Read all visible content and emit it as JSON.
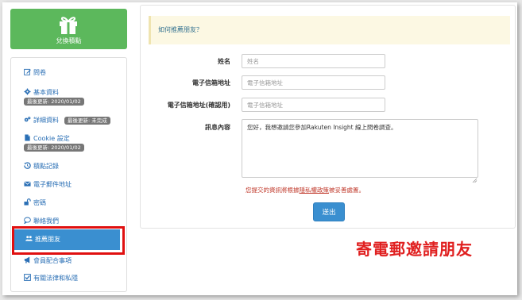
{
  "redeem": {
    "label": "兌換積點"
  },
  "sidebar": {
    "items": [
      {
        "label": "問卷",
        "icon": "edit-icon"
      },
      {
        "label": "基本資料",
        "icon": "gear-icon",
        "badge": "最後更新: 2020/01/02"
      },
      {
        "label": "詳細資料",
        "icon": "gears-icon",
        "badge": "最後更新: 未完成"
      },
      {
        "label": "Cookie 設定",
        "icon": "file-icon",
        "badge": "最後更新: 2020/01/02"
      },
      {
        "label": "積點記錄",
        "icon": "history-icon"
      },
      {
        "label": "電子郵件地址",
        "icon": "envelope-icon"
      },
      {
        "label": "密碼",
        "icon": "unlock-icon"
      },
      {
        "label": "聯絡我們",
        "icon": "comment-icon"
      },
      {
        "label": "推薦朋友",
        "icon": "users-icon",
        "active": true
      },
      {
        "label": "會員配合事項",
        "icon": "bullhorn-icon"
      },
      {
        "label": "有關法律和私隱",
        "icon": "check-square-icon"
      }
    ]
  },
  "form": {
    "banner": "如何推薦朋友？",
    "name_label": "姓名",
    "name_placeholder": "姓名",
    "email_label": "電子信箱地址",
    "email_placeholder": "電子信箱地址",
    "email_confirm_label": "電子信箱地址(確認用)",
    "email_confirm_placeholder": "電子信箱地址",
    "message_label": "訊息內容",
    "message_value": "您好，我想邀請您參加Rakuten Insight 線上問卷調查。",
    "privacy_before": "您提交的資訊將根據",
    "privacy_link": "隱私權政策",
    "privacy_after": "被妥善處置。",
    "send_label": "送出"
  },
  "annotation": "寄電郵邀請朋友",
  "colors": {
    "accent_blue": "#3a8fd0",
    "green": "#5cb85c",
    "highlight_red": "#e01010",
    "banner_bg": "#fcf8e3"
  }
}
